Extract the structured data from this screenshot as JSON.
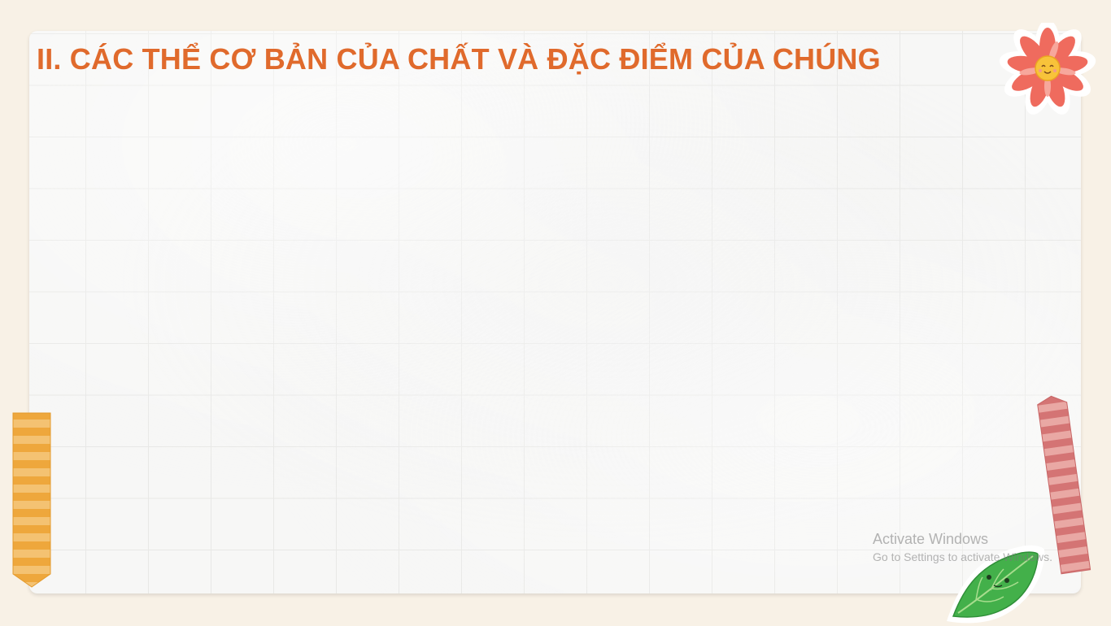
{
  "slide": {
    "title": "II. CÁC THỂ CƠ BẢN CỦA CHẤT VÀ ĐẶC ĐIỂM CỦA CHÚNG"
  },
  "decorations": {
    "top_right": "flower-sticker-icon",
    "bottom_right": "leaf-sticker-icon",
    "tape_left_color": "#efad42",
    "tape_right_color": "#d77f7f",
    "title_color": "#e06a2c"
  },
  "watermark": {
    "line1": "Activate Windows",
    "line2": "Go to Settings to activate Windows."
  }
}
